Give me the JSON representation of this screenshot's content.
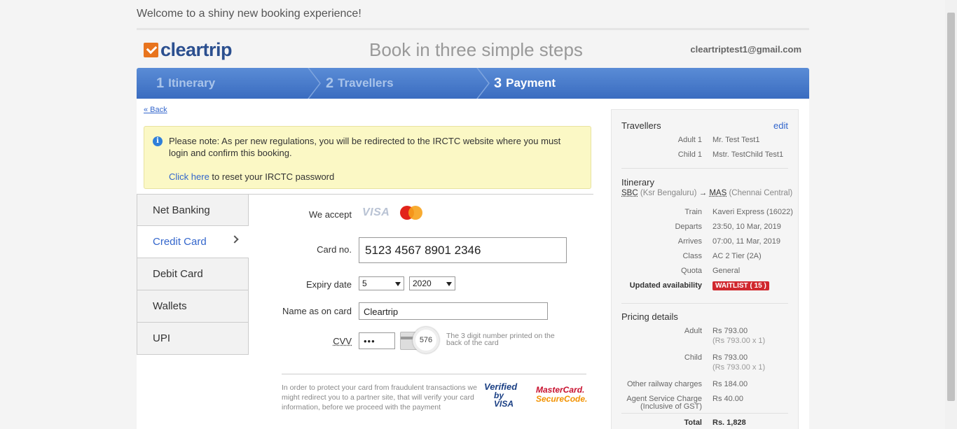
{
  "header": {
    "welcome": "Welcome to a shiny new booking experience!",
    "brand": "cleartrip",
    "tagline": "Book in three simple steps",
    "user_email": "cleartriptest1@gmail.com"
  },
  "steps": [
    {
      "num": "1",
      "label": "Itinerary"
    },
    {
      "num": "2",
      "label": "Travellers"
    },
    {
      "num": "3",
      "label": "Payment"
    }
  ],
  "back_label": "« Back",
  "notice": {
    "text": "Please note: As per new regulations, you will be redirected to the IRCTC website where you must login and confirm this booking.",
    "link": "Click here",
    "link_suffix": " to reset your IRCTC password"
  },
  "payment_tabs": [
    "Net Banking",
    "Credit Card",
    "Debit Card",
    "Wallets",
    "UPI"
  ],
  "form": {
    "we_accept": "We accept",
    "visa": "VISA",
    "card_no_label": "Card no.",
    "card_no_value": "5123 4567 8901 2346",
    "expiry_label": "Expiry date",
    "expiry_month": "5",
    "expiry_year": "2020",
    "name_label": "Name as on card",
    "name_value": "Cleartrip",
    "cvv_label": "CVV",
    "cvv_value": "•••",
    "cvv_sample": "576",
    "cvv_help": "The 3 digit number printed on the back of the card",
    "protect_text": "In order to protect your card from fraudulent transactions we might redirect you to a partner site, that will verify your card information, before we proceed with the payment",
    "vbv_line1": "Verified",
    "vbv_line2": "by VISA",
    "mc_line1": "MasterCard.",
    "mc_line2": "SecureCode."
  },
  "summary": {
    "travellers_title": "Travellers",
    "edit": "edit",
    "travellers": [
      {
        "k": "Adult 1",
        "v": "Mr. Test Test1"
      },
      {
        "k": "Child 1",
        "v": "Mstr. TestChild Test1"
      }
    ],
    "itinerary_title": "Itinerary",
    "from_code": "SBC",
    "from_name": "(Ksr Bengaluru)",
    "arrow": "→",
    "to_code": "MAS",
    "to_name": "(Chennai Central)",
    "details": [
      {
        "k": "Train",
        "v": "Kaveri Express (16022)"
      },
      {
        "k": "Departs",
        "v": "23:50, 10 Mar, 2019"
      },
      {
        "k": "Arrives",
        "v": "07:00, 11 Mar, 2019"
      },
      {
        "k": "Class",
        "v": "AC 2 Tier (2A)"
      },
      {
        "k": "Quota",
        "v": "General"
      }
    ],
    "availability_label": "Updated availability",
    "availability_value": "WAITLIST ( 15 )",
    "pricing_title": "Pricing details",
    "adult_label": "Adult",
    "adult_value": "Rs 793.00",
    "adult_calc": "(Rs 793.00 x 1)",
    "child_label": "Child",
    "child_value": "Rs 793.00",
    "child_calc": "(Rs 793.00 x 1)",
    "railway_label": "Other railway charges",
    "railway_value": "Rs 184.00",
    "agent_label": "Agent Service Charge",
    "agent_label2": "(Inclusive of GST)",
    "agent_value": "Rs 40.00",
    "total_label": "Total",
    "total_value": "Rs. 1,828"
  },
  "colors": {
    "brand_blue": "#2b4f8f",
    "brand_orange": "#e8741e",
    "link": "#3366cc",
    "waitlist": "#d0282e",
    "notice_bg": "#fbf8c5"
  }
}
